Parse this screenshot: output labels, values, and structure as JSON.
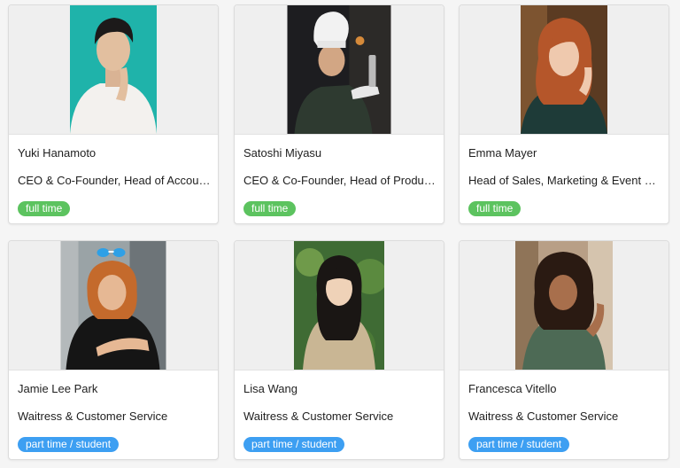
{
  "colors": {
    "full_time_badge": "#5cc35f",
    "part_time_badge": "#3d9ff2",
    "photo_placeholder": "#efefef"
  },
  "team": [
    {
      "name": "Yuki Hanamoto",
      "role": "CEO & Co-Founder, Head of Accounting",
      "employment": "full time"
    },
    {
      "name": "Satoshi Miyasu",
      "role": "CEO & Co-Founder, Head of Production",
      "employment": "full time"
    },
    {
      "name": "Emma Mayer",
      "role": "Head of Sales, Marketing & Event Management",
      "employment": "full time"
    },
    {
      "name": "Jamie Lee Park",
      "role": "Waitress & Customer Service",
      "employment": "part time / student"
    },
    {
      "name": "Lisa Wang",
      "role": "Waitress & Customer Service",
      "employment": "part time / student"
    },
    {
      "name": "Francesca Vitello",
      "role": "Waitress & Customer Service",
      "employment": "part time / student"
    }
  ]
}
